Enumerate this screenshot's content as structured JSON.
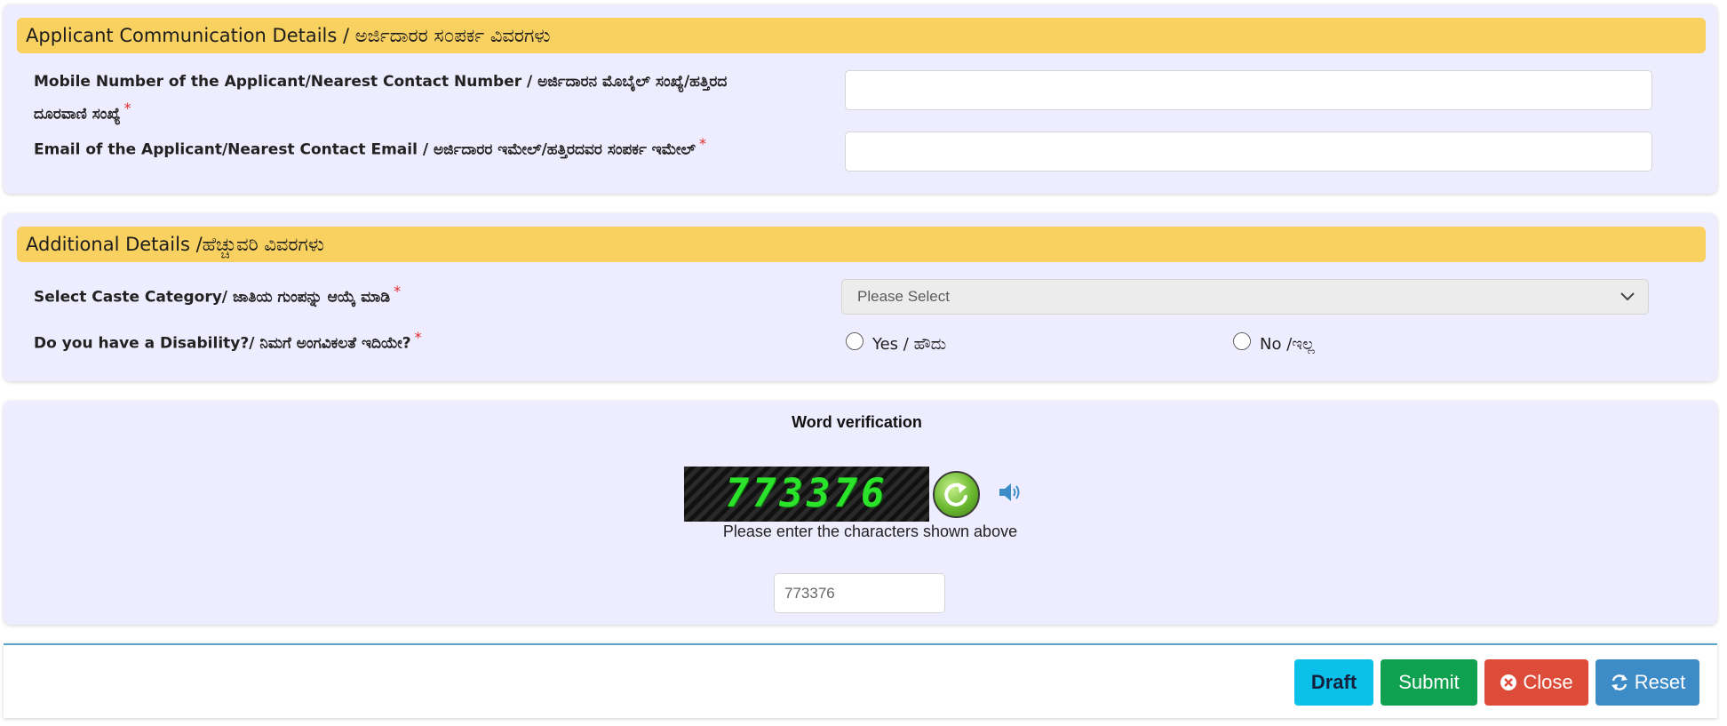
{
  "communication": {
    "header": "Applicant Communication Details / ಅರ್ಜಿದಾರರ ಸ೦ಪರ್ಕ ವಿವರಗಳು",
    "mobile_label_line1": "Mobile Number of the Applicant/Nearest Contact Number / ಅರ್ಜಿದಾರನ ಮೊಬೈಲ್ ಸಂಖ್ಯೆ/ಹತ್ತಿರದ",
    "mobile_label_line2": "ದೂರವಾಣಿ ಸಂಖ್ಯೆ",
    "mobile_value": "",
    "email_label": "Email of the Applicant/Nearest Contact Email / ಅರ್ಜಿದಾರರ ಇಮೇಲ್/ಹತ್ತಿರದವರ ಸಂಪರ್ಕ ಇಮೇಲ್",
    "email_value": "",
    "required_mark": "*"
  },
  "additional": {
    "header": "Additional Details /ಹೆಚ್ಚುವರಿ ವಿವರಗಳು",
    "caste_label": "Select Caste Category/ ಜಾತಿಯ ಗುಂಪನ್ನು ಆಯ್ಕೆ ಮಾಡಿ",
    "caste_selected": "Please Select",
    "disability_label": "Do you have a Disability?/ ನಿಮಗೆ ಅಂಗವಿಕಲತೆ ಇದಿಯೇ?",
    "option_yes": "Yes / ಹೌದು",
    "option_no": "No /ಇಲ್ಲ",
    "required_mark": "*"
  },
  "captcha": {
    "title": "Word verification",
    "image_text": "773376",
    "hint": "Please enter the characters shown above",
    "input_value": "773376",
    "icons": [
      "refresh-icon",
      "speaker-icon"
    ]
  },
  "footer": {
    "draft_label": "Draft",
    "submit_label": "Submit",
    "close_label": "Close",
    "reset_label": "Reset",
    "icons": [
      "close-circle-icon",
      "refresh-arrows-icon"
    ]
  },
  "colors": {
    "panel_bg": "#eeedff",
    "header_bar": "#f9d160",
    "draft": "#0bc1ea",
    "submit": "#0fa14f",
    "close": "#dd4b39",
    "reset": "#3d8bc7",
    "required": "#e22a2a"
  }
}
